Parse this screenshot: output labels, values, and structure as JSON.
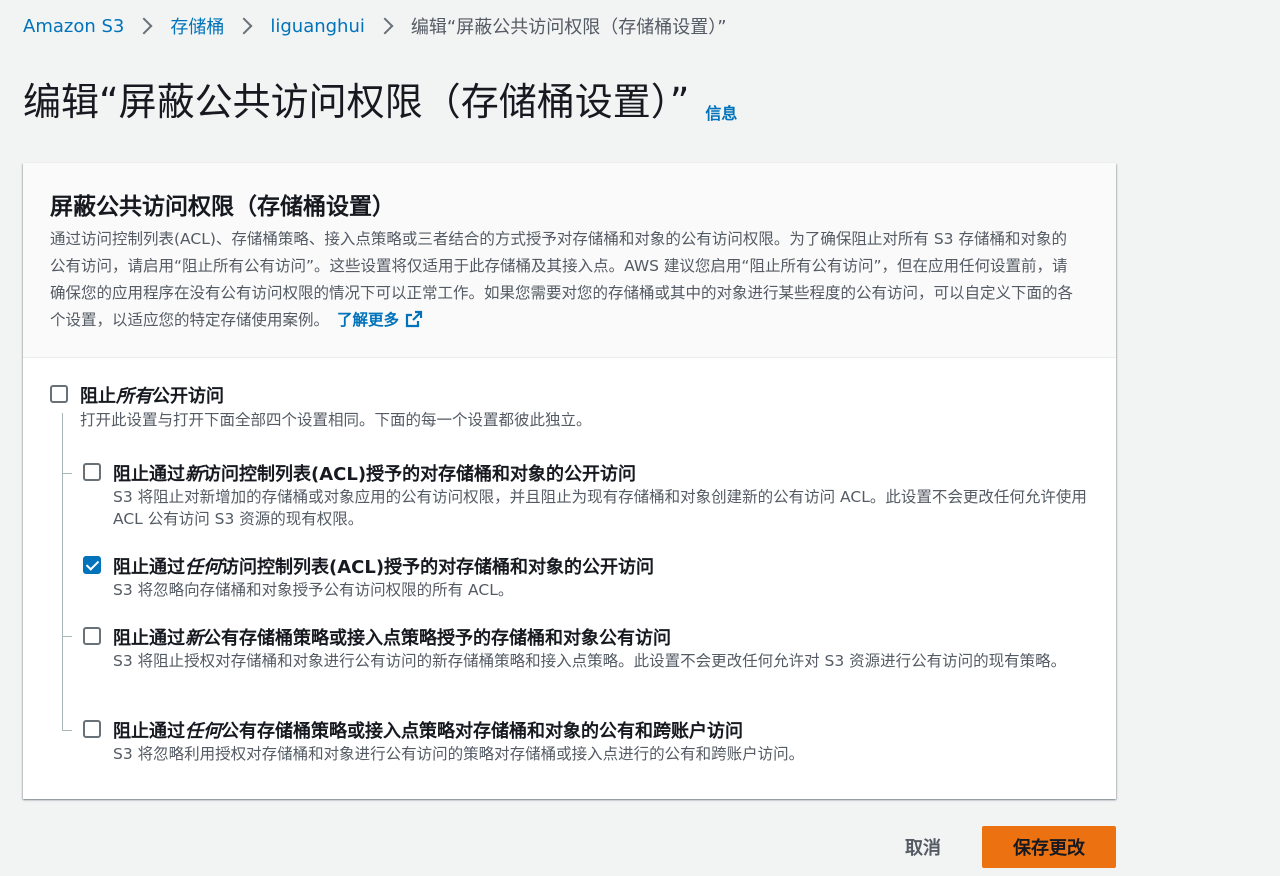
{
  "breadcrumb": {
    "items": [
      "Amazon S3",
      "存储桶",
      "liguanghui"
    ],
    "current": "编辑“屏蔽公共访问权限（存储桶设置）”"
  },
  "page": {
    "title": "编辑“屏蔽公共访问权限（存储桶设置）”",
    "info_link": "信息"
  },
  "panel": {
    "title": "屏蔽公共访问权限（存储桶设置）",
    "description": "通过访问控制列表(ACL)、存储桶策略、接入点策略或三者结合的方式授予对存储桶和对象的公有访问权限。为了确保阻止对所有 S3 存储桶和对象的公有访问，请启用“阻止所有公有访问”。这些设置将仅适用于此存储桶及其接入点。AWS 建议您启用“阻止所有公有访问”，但在应用任何设置前，请确保您的应用程序在没有公有访问权限的情况下可以正常工作。如果您需要对您的存储桶或其中的对象进行某些程度的公有访问，可以自定义下面的各个设置，以适应您的特定存储使用案例。",
    "learn_more": "了解更多",
    "external_icon": "external-link-icon"
  },
  "block_all": {
    "label_prefix": "阻止",
    "label_emphasis": "所有",
    "label_suffix": "公开访问",
    "description": "打开此设置与打开下面全部四个设置相同。下面的每一个设置都彼此独立。",
    "checked": false
  },
  "options": [
    {
      "label_prefix": "阻止通过",
      "label_emphasis": "新",
      "label_suffix": "访问控制列表(ACL)授予的对存储桶和对象的公开访问",
      "description": "S3 将阻止对新增加的存储桶或对象应用的公有访问权限，并且阻止为现有存储桶和对象创建新的公有访问 ACL。此设置不会更改任何允许使用 ACL 公有访问 S3 资源的现有权限。",
      "checked": false
    },
    {
      "label_prefix": "阻止通过",
      "label_emphasis": "任何",
      "label_suffix": "访问控制列表(ACL)授予的对存储桶和对象的公开访问",
      "description": "S3 将忽略向存储桶和对象授予公有访问权限的所有 ACL。",
      "checked": true
    },
    {
      "label_prefix": "阻止通过",
      "label_emphasis": "新",
      "label_suffix": "公有存储桶策略或接入点策略授予的存储桶和对象公有访问",
      "description": "S3 将阻止授权对存储桶和对象进行公有访问的新存储桶策略和接入点策略。此设置不会更改任何允许对 S3 资源进行公有访问的现有策略。",
      "checked": false
    },
    {
      "label_prefix": "阻止通过",
      "label_emphasis": "任何",
      "label_suffix": "公有存储桶策略或接入点策略对存储桶和对象的公有和跨账户访问",
      "description": "S3 将忽略利用授权对存储桶和对象进行公有访问的策略对存储桶或接入点进行的公有和跨账户访问。",
      "checked": false
    }
  ],
  "footer": {
    "cancel_label": "取消",
    "save_label": "保存更改"
  },
  "colors": {
    "link": "#0073bb",
    "primary_button": "#ec7211",
    "checkbox_checked": "#0073bb",
    "page_background": "#f2f3f3"
  }
}
